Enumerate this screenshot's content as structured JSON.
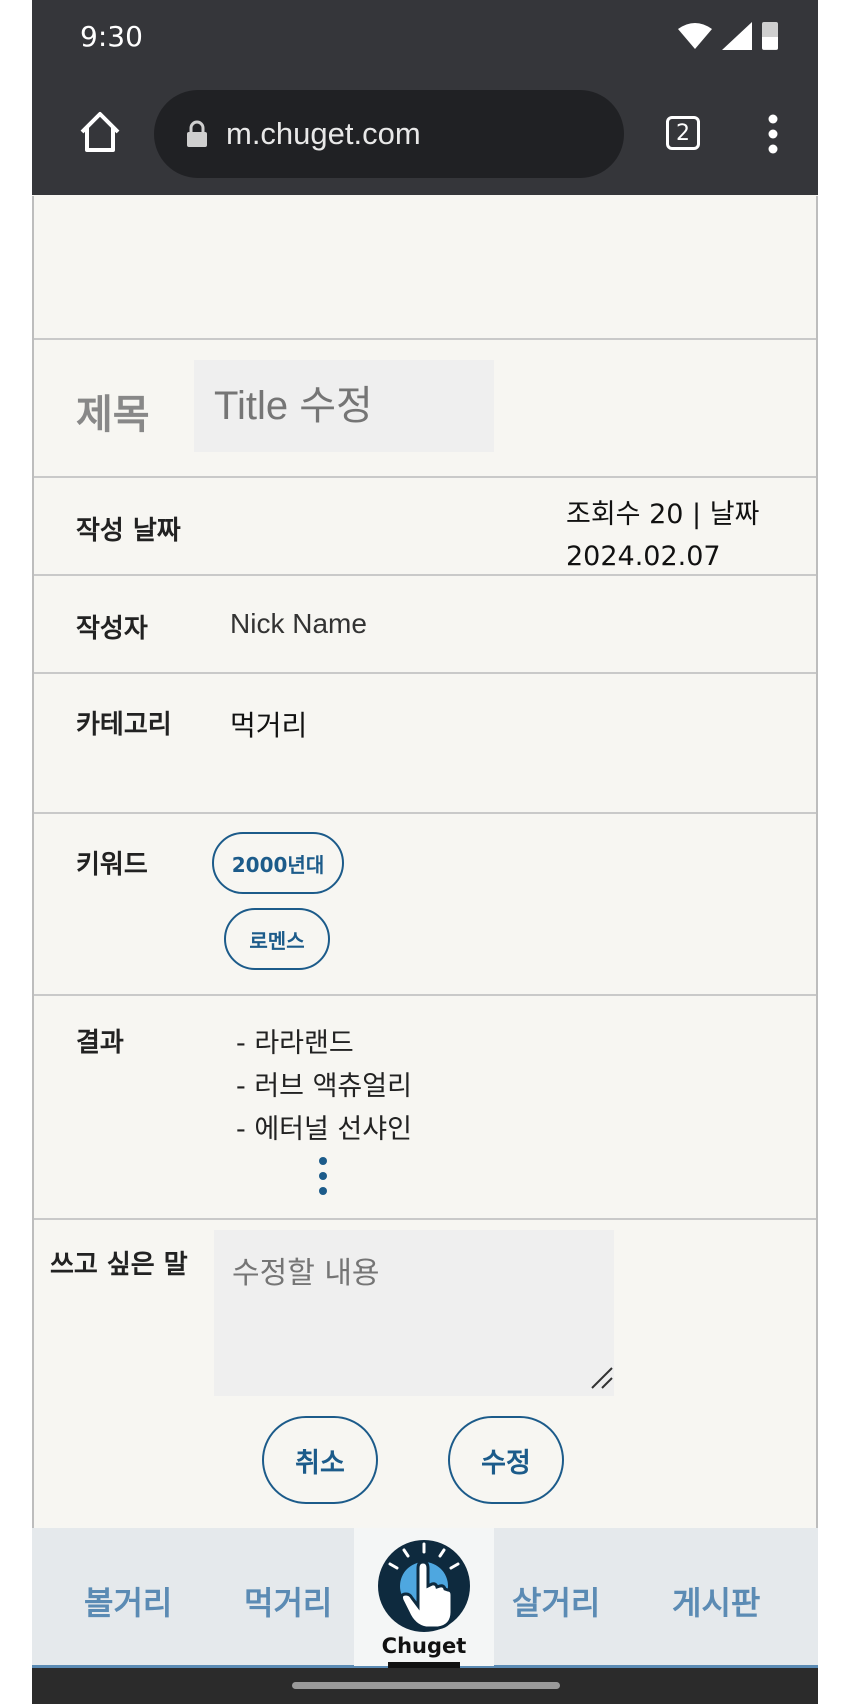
{
  "status_bar": {
    "time": "9:30"
  },
  "browser": {
    "url": "m.chuget.com",
    "tab_count": "2"
  },
  "post": {
    "title_label": "제목",
    "title_placeholder": "Title 수정",
    "date_label": "작성 날짜",
    "views_text": "조회수 20 |  날짜",
    "date_value": "2024.02.07",
    "author_label": "작성자",
    "author_value": "Nick Name",
    "category_label": "카테고리",
    "category_value": "먹거리",
    "keyword_label": "키워드",
    "keywords": [
      "2000년대",
      "로멘스"
    ],
    "result_label": "결과",
    "results": [
      "- 라라랜드",
      "- 러브 액츄얼리",
      "- 에터널 선샤인"
    ],
    "message_label": "쓰고 싶은 말",
    "message_placeholder": "수정할 내용",
    "cancel_label": "취소",
    "submit_label": "수정"
  },
  "bottom_nav": {
    "items": [
      "볼거리",
      "먹거리",
      "살거리",
      "게시판"
    ],
    "logo_text": "Chuget"
  },
  "colors": {
    "accent": "#1c5b8a",
    "nav_text": "#5b8bb4",
    "chrome": "#35363a"
  },
  "icons": [
    "wifi-icon",
    "signal-icon",
    "battery-icon",
    "home-icon",
    "lock-icon",
    "tabs-icon",
    "menu-icon",
    "more-dots-icon",
    "resize-icon",
    "pointer-hand-icon"
  ]
}
